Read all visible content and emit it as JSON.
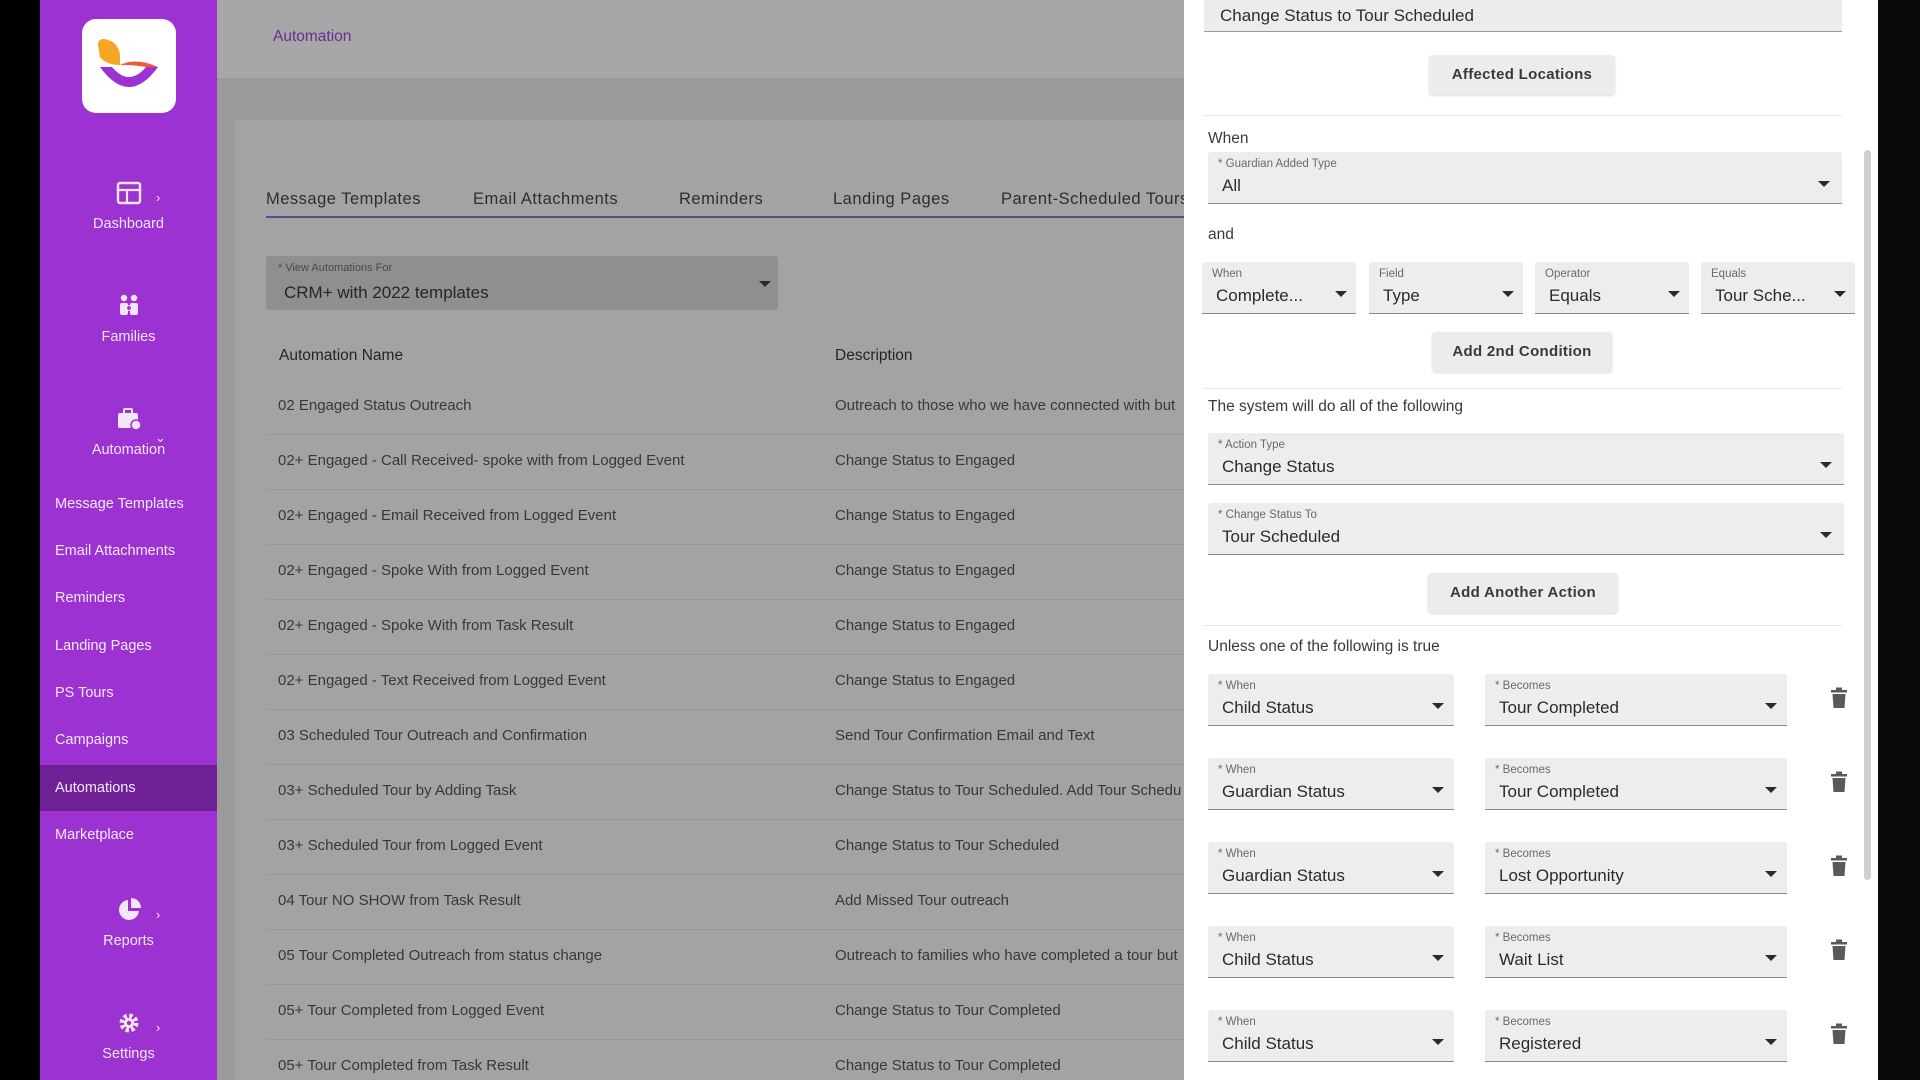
{
  "sidebar": {
    "dashboard": "Dashboard",
    "families": "Families",
    "automation": "Automation",
    "subitems": [
      "Message Templates",
      "Email Attachments",
      "Reminders",
      "Landing Pages",
      "PS Tours",
      "Campaigns",
      "Automations",
      "Marketplace"
    ],
    "active_item": "Automations",
    "reports": "Reports",
    "settings": "Settings",
    "brand_color": "#9b32d1"
  },
  "main": {
    "breadcrumb": "Automation",
    "tabs": [
      "Message Templates",
      "Email Attachments",
      "Reminders",
      "Landing Pages",
      "Parent-Scheduled Tours"
    ],
    "view_for": {
      "label": "* View Automations For",
      "value": "CRM+ with 2022 templates"
    },
    "columns": {
      "name": "Automation Name",
      "description": "Description"
    },
    "rows": [
      {
        "name": "02 Engaged Status Outreach",
        "description": "Outreach to those who we have connected with but"
      },
      {
        "name": "02+ Engaged - Call Received- spoke with from Logged Event",
        "description": "Change Status to Engaged"
      },
      {
        "name": "02+ Engaged - Email Received from Logged Event",
        "description": "Change Status to Engaged"
      },
      {
        "name": "02+ Engaged - Spoke With from Logged Event",
        "description": "Change Status to Engaged"
      },
      {
        "name": "02+ Engaged - Spoke With from Task Result",
        "description": "Change Status to Engaged"
      },
      {
        "name": "02+ Engaged - Text Received from Logged Event",
        "description": "Change Status to Engaged"
      },
      {
        "name": "03 Scheduled Tour Outreach and Confirmation",
        "description": "Send Tour Confirmation Email and Text"
      },
      {
        "name": "03+ Scheduled Tour by Adding Task",
        "description": "Change Status to Tour Scheduled. Add Tour Schedu"
      },
      {
        "name": "03+ Scheduled Tour from Logged Event",
        "description": "Change Status to Tour Scheduled"
      },
      {
        "name": "04 Tour NO SHOW from Task Result",
        "description": "Add Missed Tour outreach"
      },
      {
        "name": "05 Tour Completed Outreach from status change",
        "description": "Outreach to families who have completed a tour but"
      },
      {
        "name": "05+ Tour Completed from Logged Event",
        "description": "Change Status to Tour Completed"
      },
      {
        "name": "05+ Tour Completed from Task Result",
        "description": "Change Status to Tour Completed"
      }
    ]
  },
  "drawer": {
    "name_value": "Change Status to Tour Scheduled",
    "affected_locations": "Affected Locations",
    "when_label": "When",
    "guardian_added_type": {
      "label": "* Guardian Added Type",
      "value": "All"
    },
    "and_label": "and",
    "condition": [
      {
        "label": "When",
        "value": "Complete..."
      },
      {
        "label": "Field",
        "value": "Type"
      },
      {
        "label": "Operator",
        "value": "Equals"
      },
      {
        "label": "Equals",
        "value": "Tour Sche..."
      }
    ],
    "add_condition": "Add 2nd Condition",
    "system_label": "The system will do all of the following",
    "action_type": {
      "label": "* Action Type",
      "value": "Change Status"
    },
    "change_status_to": {
      "label": "* Change Status To",
      "value": "Tour Scheduled"
    },
    "add_action": "Add Another Action",
    "unless_label": "Unless one of the following is true",
    "when_small": "* When",
    "becomes_small": "* Becomes",
    "exceptions": [
      {
        "when": "Child Status",
        "becomes": "Tour Completed"
      },
      {
        "when": "Guardian Status",
        "becomes": "Tour Completed"
      },
      {
        "when": "Guardian Status",
        "becomes": "Lost Opportunity"
      },
      {
        "when": "Child Status",
        "becomes": "Wait List"
      },
      {
        "when": "Child Status",
        "becomes": "Registered"
      }
    ]
  }
}
